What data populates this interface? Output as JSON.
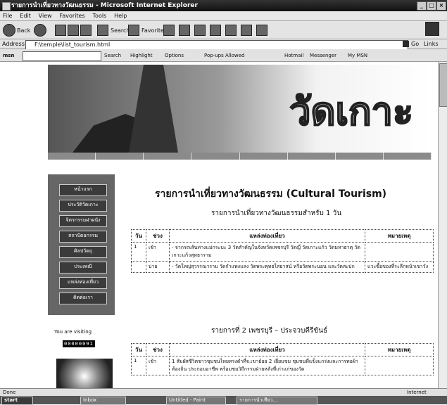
{
  "window": {
    "title": "รายการนำเที่ยวทางวัฒนธรรม - Microsoft Internet Explorer",
    "buttons": {
      "min": "_",
      "max": "□",
      "close": "×"
    }
  },
  "menu": [
    "File",
    "Edit",
    "View",
    "Favorites",
    "Tools",
    "Help"
  ],
  "toolbar": {
    "back": "Back",
    "search": "Search",
    "favorites": "Favorites"
  },
  "address": {
    "label": "Address",
    "url": "F:\\temple\\list_tourism.html",
    "go": "Go",
    "links": "Links"
  },
  "linksbar": {
    "search": "Search",
    "highlight": "Highlight",
    "options": "Options",
    "popups": "Pop-ups Allowed",
    "hotmail": "Hotmail",
    "messenger": "Messenger",
    "mymsn": "My MSN"
  },
  "banner": {
    "title": "วัดเกาะ"
  },
  "page": {
    "heading": "รายการนำเที่ยวทางวัฒนธรรม (Cultural Tourism)",
    "table1": {
      "caption": "รายการนำเที่ยวทางวัฒนธรรมสำหรับ 1 วัน",
      "headers": [
        "วัน",
        "ช่วง",
        "แหล่งท่องเที่ยว",
        "หมายเหตุ"
      ],
      "rows": [
        {
          "day": "1",
          "time": "เช้า",
          "place": "- จากรถเส้นทางแม่กระบะ 3 วัดสำคัญในจังหวัดเพชรบุรี วัดญี่ วัดเกาะแก้ว วัดมหาธาตุ วัดเกาะแก้วสุทธาราม",
          "note": ""
        },
        {
          "day": "",
          "time": "บ่าย",
          "place": "- วัดใหญ่สุวรรณาราม วัดกำแพงแลง วัดพระพุทธไสยาสน์ หรือวัดพระนอน และวัดสะปก",
          "note": "แวะซื้อของที่ระลึกหน้าเขาวัง"
        }
      ]
    },
    "table2": {
      "caption": "รายการที่ 2 เพชรบุรี – ประจวบคีรีขันธ์",
      "headers": [
        "วัน",
        "ช่วง",
        "แหล่งท่องเที่ยว",
        "หมายเหตุ"
      ],
      "rows": [
        {
          "day": "1",
          "time": "เช้า",
          "place": "1  สัมผัสชีวิตชาวชุมชนไทยทรงดำที่จ.เขาย้อย  2  เยี่ยมชม ชุมชนที่แข็งแกร่งและการทอผ้าท้องถิ่น ประกอบอาชีพ พร้อมชมวิถีกรรมฝ่ายหลังที่เก่าแก่ของวัด",
          "note": ""
        }
      ]
    }
  },
  "sidebar": {
    "items": [
      "หน้าแรก",
      "ประวัติวัดเกาะ",
      "จิตรกรรมฝาผนัง",
      "สถาปัตยกรรม",
      "ศิลปวัตถุ",
      "ประเพณี",
      "แหล่งท่องเที่ยว",
      "ติดต่อเรา"
    ],
    "counter_label": "You are visiting",
    "counter_value": "00000091"
  },
  "status": {
    "left": "Done",
    "zone": "Internet"
  },
  "taskbar": {
    "start": "start",
    "items": [
      "Inbox",
      "Untitled - Paint",
      "รายการนำเที่ยว..."
    ],
    "clock": ""
  },
  "colors": {
    "banner_gradient_dark": "#555555",
    "banner_gradient_light": "#f2f2f2",
    "sidebar_bg": "#666666"
  }
}
